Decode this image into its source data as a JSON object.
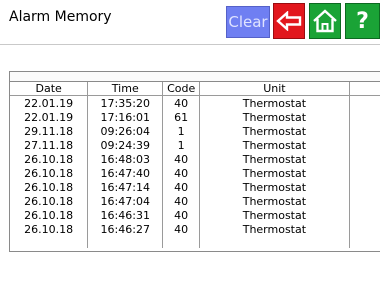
{
  "header": {
    "title": "Alarm Memory",
    "clear_label": "Clear",
    "help_label": "?"
  },
  "colors": {
    "clear_bg": "#6f7ff2",
    "back_bg": "#e2171d",
    "home_bg": "#1aa336",
    "help_bg": "#1aa336"
  },
  "icons": {
    "back": "arrow-left-icon",
    "home": "home-icon"
  },
  "table": {
    "columns": [
      "Date",
      "Time",
      "Code",
      "Unit"
    ],
    "rows": [
      {
        "date": "22.01.19",
        "time": "17:35:20",
        "code": "40",
        "unit": "Thermostat"
      },
      {
        "date": "22.01.19",
        "time": "17:16:01",
        "code": "61",
        "unit": "Thermostat"
      },
      {
        "date": "29.11.18",
        "time": "09:26:04",
        "code": "1",
        "unit": "Thermostat"
      },
      {
        "date": "27.11.18",
        "time": "09:24:39",
        "code": "1",
        "unit": "Thermostat"
      },
      {
        "date": "26.10.18",
        "time": "16:48:03",
        "code": "40",
        "unit": "Thermostat"
      },
      {
        "date": "26.10.18",
        "time": "16:47:40",
        "code": "40",
        "unit": "Thermostat"
      },
      {
        "date": "26.10.18",
        "time": "16:47:14",
        "code": "40",
        "unit": "Thermostat"
      },
      {
        "date": "26.10.18",
        "time": "16:47:04",
        "code": "40",
        "unit": "Thermostat"
      },
      {
        "date": "26.10.18",
        "time": "16:46:31",
        "code": "40",
        "unit": "Thermostat"
      },
      {
        "date": "26.10.18",
        "time": "16:46:27",
        "code": "40",
        "unit": "Thermostat"
      }
    ]
  }
}
